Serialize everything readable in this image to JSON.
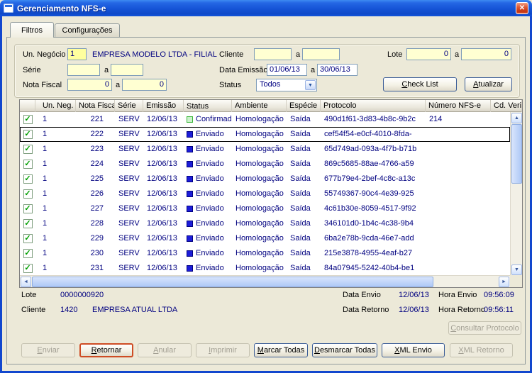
{
  "window": {
    "title": "Gerenciamento NFS-e"
  },
  "icons": {
    "close": "✕",
    "dropdown": "▼",
    "check": "✓",
    "scroll_up": "▲",
    "scroll_down": "▼",
    "scroll_left": "◄",
    "scroll_right": "►"
  },
  "tabs": {
    "filtros": "Filtros",
    "configuracoes": "Configurações"
  },
  "filters": {
    "un_negocio_label": "Un. Negócio",
    "un_negocio_value": "1",
    "empresa": "EMPRESA MODELO LTDA - FILIAL",
    "cliente_label": "Cliente",
    "cliente_from": "",
    "cliente_to": "",
    "a_label": "a",
    "lote_label": "Lote",
    "lote_from": "0",
    "lote_to": "0",
    "serie_label": "Série",
    "serie_from": "",
    "serie_to": "",
    "data_emissao_label": "Data Emissão",
    "data_emissao_from": "01/06/13",
    "data_emissao_to": "30/06/13",
    "nota_fiscal_label": "Nota Fiscal",
    "nota_fiscal_from": "0",
    "nota_fiscal_to": "0",
    "status_label": "Status",
    "status_value": "Todos",
    "check_list_button": "Check List",
    "atualizar_button": "Atualizar"
  },
  "table": {
    "columns": [
      "",
      "Un. Neg.",
      "Nota Fiscal",
      "Série",
      "Emissão",
      "Status",
      "Ambiente",
      "Espécie",
      "Protocolo",
      "Número NFS-e",
      "Cd. Verificação"
    ],
    "rows": [
      {
        "checked": true,
        "un_neg": "1",
        "nota_fiscal": "221",
        "serie": "SERV",
        "emissao": "12/06/13",
        "status": "Confirmado",
        "ambiente": "Homologação",
        "especie": "Saída",
        "protocolo": "490d1f61-3d83-4b8c-9b2c",
        "numero_nfse": "214",
        "selected": false
      },
      {
        "checked": true,
        "un_neg": "1",
        "nota_fiscal": "222",
        "serie": "SERV",
        "emissao": "12/06/13",
        "status": "Enviado",
        "ambiente": "Homologação",
        "especie": "Saída",
        "protocolo": "cef54f54-e0cf-4010-8fda-",
        "numero_nfse": "",
        "selected": true
      },
      {
        "checked": true,
        "un_neg": "1",
        "nota_fiscal": "223",
        "serie": "SERV",
        "emissao": "12/06/13",
        "status": "Enviado",
        "ambiente": "Homologação",
        "especie": "Saída",
        "protocolo": "65d749ad-093a-4f7b-b71b",
        "numero_nfse": "",
        "selected": false
      },
      {
        "checked": true,
        "un_neg": "1",
        "nota_fiscal": "224",
        "serie": "SERV",
        "emissao": "12/06/13",
        "status": "Enviado",
        "ambiente": "Homologação",
        "especie": "Saída",
        "protocolo": "869c5685-88ae-4766-a59",
        "numero_nfse": "",
        "selected": false
      },
      {
        "checked": true,
        "un_neg": "1",
        "nota_fiscal": "225",
        "serie": "SERV",
        "emissao": "12/06/13",
        "status": "Enviado",
        "ambiente": "Homologação",
        "especie": "Saída",
        "protocolo": "677b79e4-2bef-4c8c-a13c",
        "numero_nfse": "",
        "selected": false
      },
      {
        "checked": true,
        "un_neg": "1",
        "nota_fiscal": "226",
        "serie": "SERV",
        "emissao": "12/06/13",
        "status": "Enviado",
        "ambiente": "Homologação",
        "especie": "Saída",
        "protocolo": "55749367-90c4-4e39-925",
        "numero_nfse": "",
        "selected": false
      },
      {
        "checked": true,
        "un_neg": "1",
        "nota_fiscal": "227",
        "serie": "SERV",
        "emissao": "12/06/13",
        "status": "Enviado",
        "ambiente": "Homologação",
        "especie": "Saída",
        "protocolo": "4c61b30e-8059-4517-9f92",
        "numero_nfse": "",
        "selected": false
      },
      {
        "checked": true,
        "un_neg": "1",
        "nota_fiscal": "228",
        "serie": "SERV",
        "emissao": "12/06/13",
        "status": "Enviado",
        "ambiente": "Homologação",
        "especie": "Saída",
        "protocolo": "346101d0-1b4c-4c38-9b4",
        "numero_nfse": "",
        "selected": false
      },
      {
        "checked": true,
        "un_neg": "1",
        "nota_fiscal": "229",
        "serie": "SERV",
        "emissao": "12/06/13",
        "status": "Enviado",
        "ambiente": "Homologação",
        "especie": "Saída",
        "protocolo": "6ba2e78b-9cda-46e7-add",
        "numero_nfse": "",
        "selected": false
      },
      {
        "checked": true,
        "un_neg": "1",
        "nota_fiscal": "230",
        "serie": "SERV",
        "emissao": "12/06/13",
        "status": "Enviado",
        "ambiente": "Homologação",
        "especie": "Saída",
        "protocolo": "215e3878-4955-4eaf-b27",
        "numero_nfse": "",
        "selected": false
      },
      {
        "checked": true,
        "un_neg": "1",
        "nota_fiscal": "231",
        "serie": "SERV",
        "emissao": "12/06/13",
        "status": "Enviado",
        "ambiente": "Homologação",
        "especie": "Saída",
        "protocolo": "84a07945-5242-40b4-be1",
        "numero_nfse": "",
        "selected": false
      }
    ]
  },
  "summary": {
    "lote_label": "Lote",
    "lote_value": "0000000920",
    "cliente_label": "Cliente",
    "cliente_code": "1420",
    "cliente_name": "EMPRESA ATUAL LTDA",
    "data_envio_label": "Data Envio",
    "data_envio_value": "12/06/13",
    "hora_envio_label": "Hora Envio",
    "hora_envio_value": "09:56:09",
    "data_retorno_label": "Data Retorno",
    "data_retorno_value": "12/06/13",
    "hora_retorno_label": "Hora Retorno",
    "hora_retorno_value": "09:56:11"
  },
  "buttons": {
    "consultar_protocolo": {
      "label": "Consultar Protocolo",
      "enabled": false
    },
    "enviar": {
      "label": "Enviar",
      "enabled": false
    },
    "retornar": {
      "label": "Retornar",
      "enabled": true
    },
    "anular": {
      "label": "Anular",
      "enabled": false
    },
    "imprimir": {
      "label": "Imprimir",
      "enabled": false
    },
    "marcar_todas": {
      "label": "Marcar Todas",
      "enabled": true
    },
    "desmarcar_todas": {
      "label": "Desmarcar Todas",
      "enabled": true
    },
    "xml_envio": {
      "label": "XML Envio",
      "enabled": true
    },
    "xml_retorno": {
      "label": "XML Retorno",
      "enabled": false
    }
  },
  "colors": {
    "titlebar_blue": "#1553D6",
    "value_navy": "#000080",
    "field_yellow": "#FFFFD2",
    "status_enviado_fill": "#1C1CD8",
    "status_enviado_border": "#000080",
    "status_confirmado_fill": "#CCF2CC",
    "status_confirmado_border": "#39B539"
  }
}
